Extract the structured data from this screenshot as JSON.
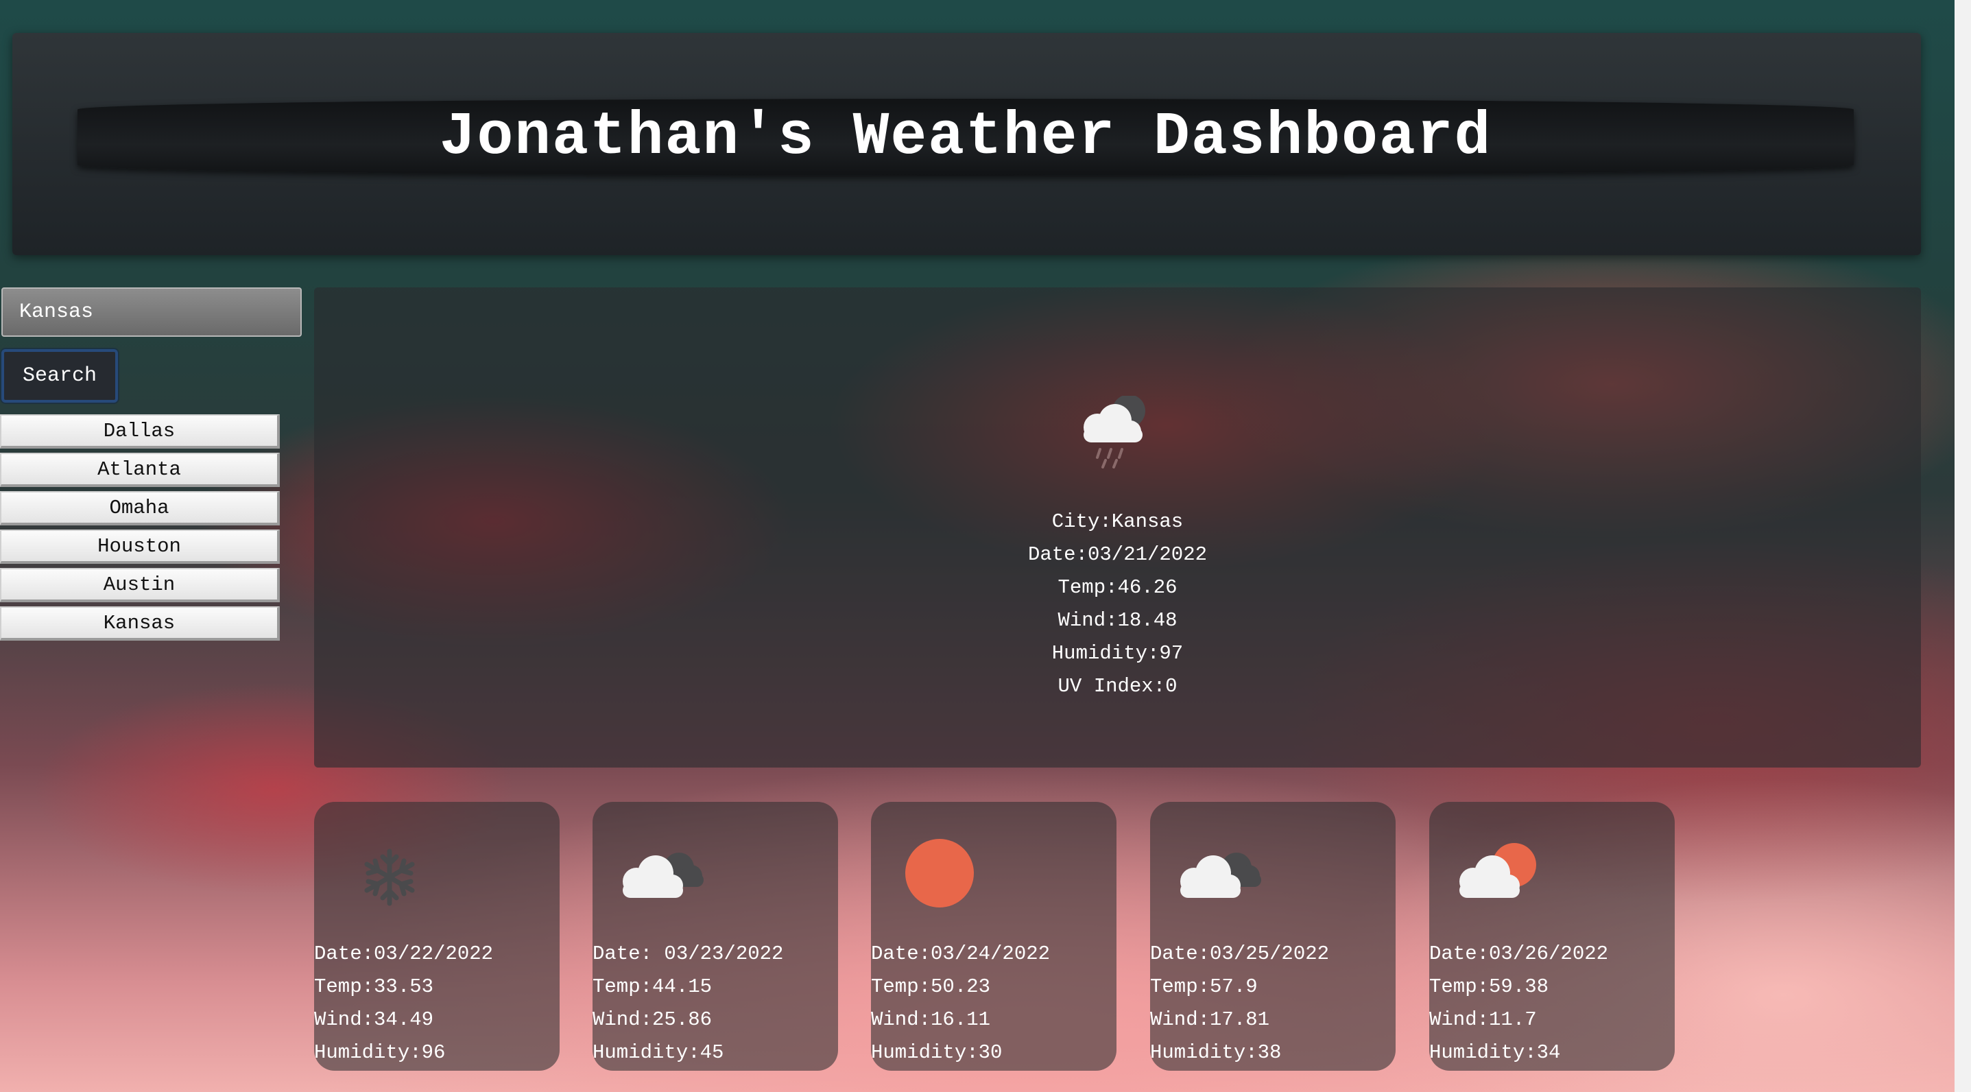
{
  "header": {
    "title": "Jonathan's Weather Dashboard"
  },
  "search": {
    "value": "Kansas",
    "button_label": "Search"
  },
  "history": [
    "Dallas",
    "Atlanta",
    "Omaha",
    "Houston",
    "Austin",
    "Kansas"
  ],
  "current": {
    "icon": "rain-cloud-icon",
    "city": "City:Kansas",
    "date": "Date:03/21/2022",
    "temp": "Temp:46.26",
    "wind": "Wind:18.48",
    "humidity": "Humidity:97",
    "uv": "UV Index:0"
  },
  "forecast": [
    {
      "icon": "snowflake-icon",
      "date": "Date:03/22/2022",
      "temp": "Temp:33.53",
      "wind": "Wind:34.49",
      "humidity": "Humidity:96"
    },
    {
      "icon": "broken-clouds-icon",
      "date": "Date: 03/23/2022",
      "temp": "Temp:44.15",
      "wind": "Wind:25.86",
      "humidity": "Humidity:45"
    },
    {
      "icon": "sun-icon",
      "date": "Date:03/24/2022",
      "temp": "Temp:50.23",
      "wind": "Wind:16.11",
      "humidity": "Humidity:30"
    },
    {
      "icon": "broken-clouds-icon",
      "date": "Date:03/25/2022",
      "temp": "Temp:57.9",
      "wind": "Wind:17.81",
      "humidity": "Humidity:38"
    },
    {
      "icon": "partly-cloudy-icon",
      "date": "Date:03/26/2022",
      "temp": "Temp:59.38",
      "wind": "Wind:11.7",
      "humidity": "Humidity:34"
    }
  ],
  "colors": {
    "sun": "#e8674a",
    "cloud": "#f2f2f2",
    "dark_cloud": "#4a4a4c"
  }
}
